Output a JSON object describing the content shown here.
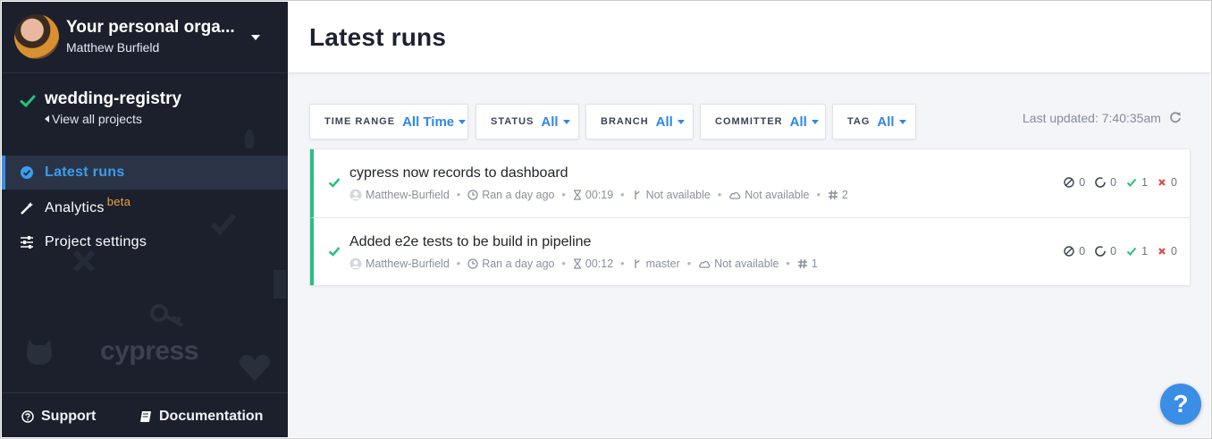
{
  "sidebar": {
    "org_name": "Your personal orga...",
    "org_user": "Matthew Burfield",
    "project_name": "wedding-registry",
    "view_all": "View all projects",
    "nav": [
      {
        "label": "Latest runs",
        "icon": "check-circle-icon",
        "active": true
      },
      {
        "label": "Analytics",
        "badge": "beta",
        "icon": "magic-wand-icon",
        "active": false
      },
      {
        "label": "Project settings",
        "icon": "sliders-icon",
        "active": false
      }
    ],
    "logo_text": "cypress",
    "footer": {
      "support": "Support",
      "documentation": "Documentation"
    }
  },
  "header": {
    "title": "Latest runs"
  },
  "filters": [
    {
      "label": "TIME RANGE",
      "value": "All Time"
    },
    {
      "label": "STATUS",
      "value": "All"
    },
    {
      "label": "BRANCH",
      "value": "All"
    },
    {
      "label": "COMMITTER",
      "value": "All"
    },
    {
      "label": "TAG",
      "value": "All"
    }
  ],
  "last_updated": "Last updated: 7:40:35am",
  "runs": [
    {
      "title": "cypress now records to dashboard",
      "author": "Matthew-Burfield",
      "ran": "Ran a day ago",
      "duration": "00:19",
      "branch": "Not available",
      "ci": "Not available",
      "number": "2",
      "skipped": "0",
      "pending": "0",
      "passed": "1",
      "failed": "0"
    },
    {
      "title": "Added e2e tests to be build in pipeline",
      "author": "Matthew-Burfield",
      "ran": "Ran a day ago",
      "duration": "00:12",
      "branch": "master",
      "ci": "Not available",
      "number": "1",
      "skipped": "0",
      "pending": "0",
      "passed": "1",
      "failed": "0"
    }
  ],
  "help_label": "?",
  "colors": {
    "accent": "#3a8ee6",
    "success": "#28c081",
    "failed": "#e04848",
    "sidebar": "#1c202c"
  }
}
